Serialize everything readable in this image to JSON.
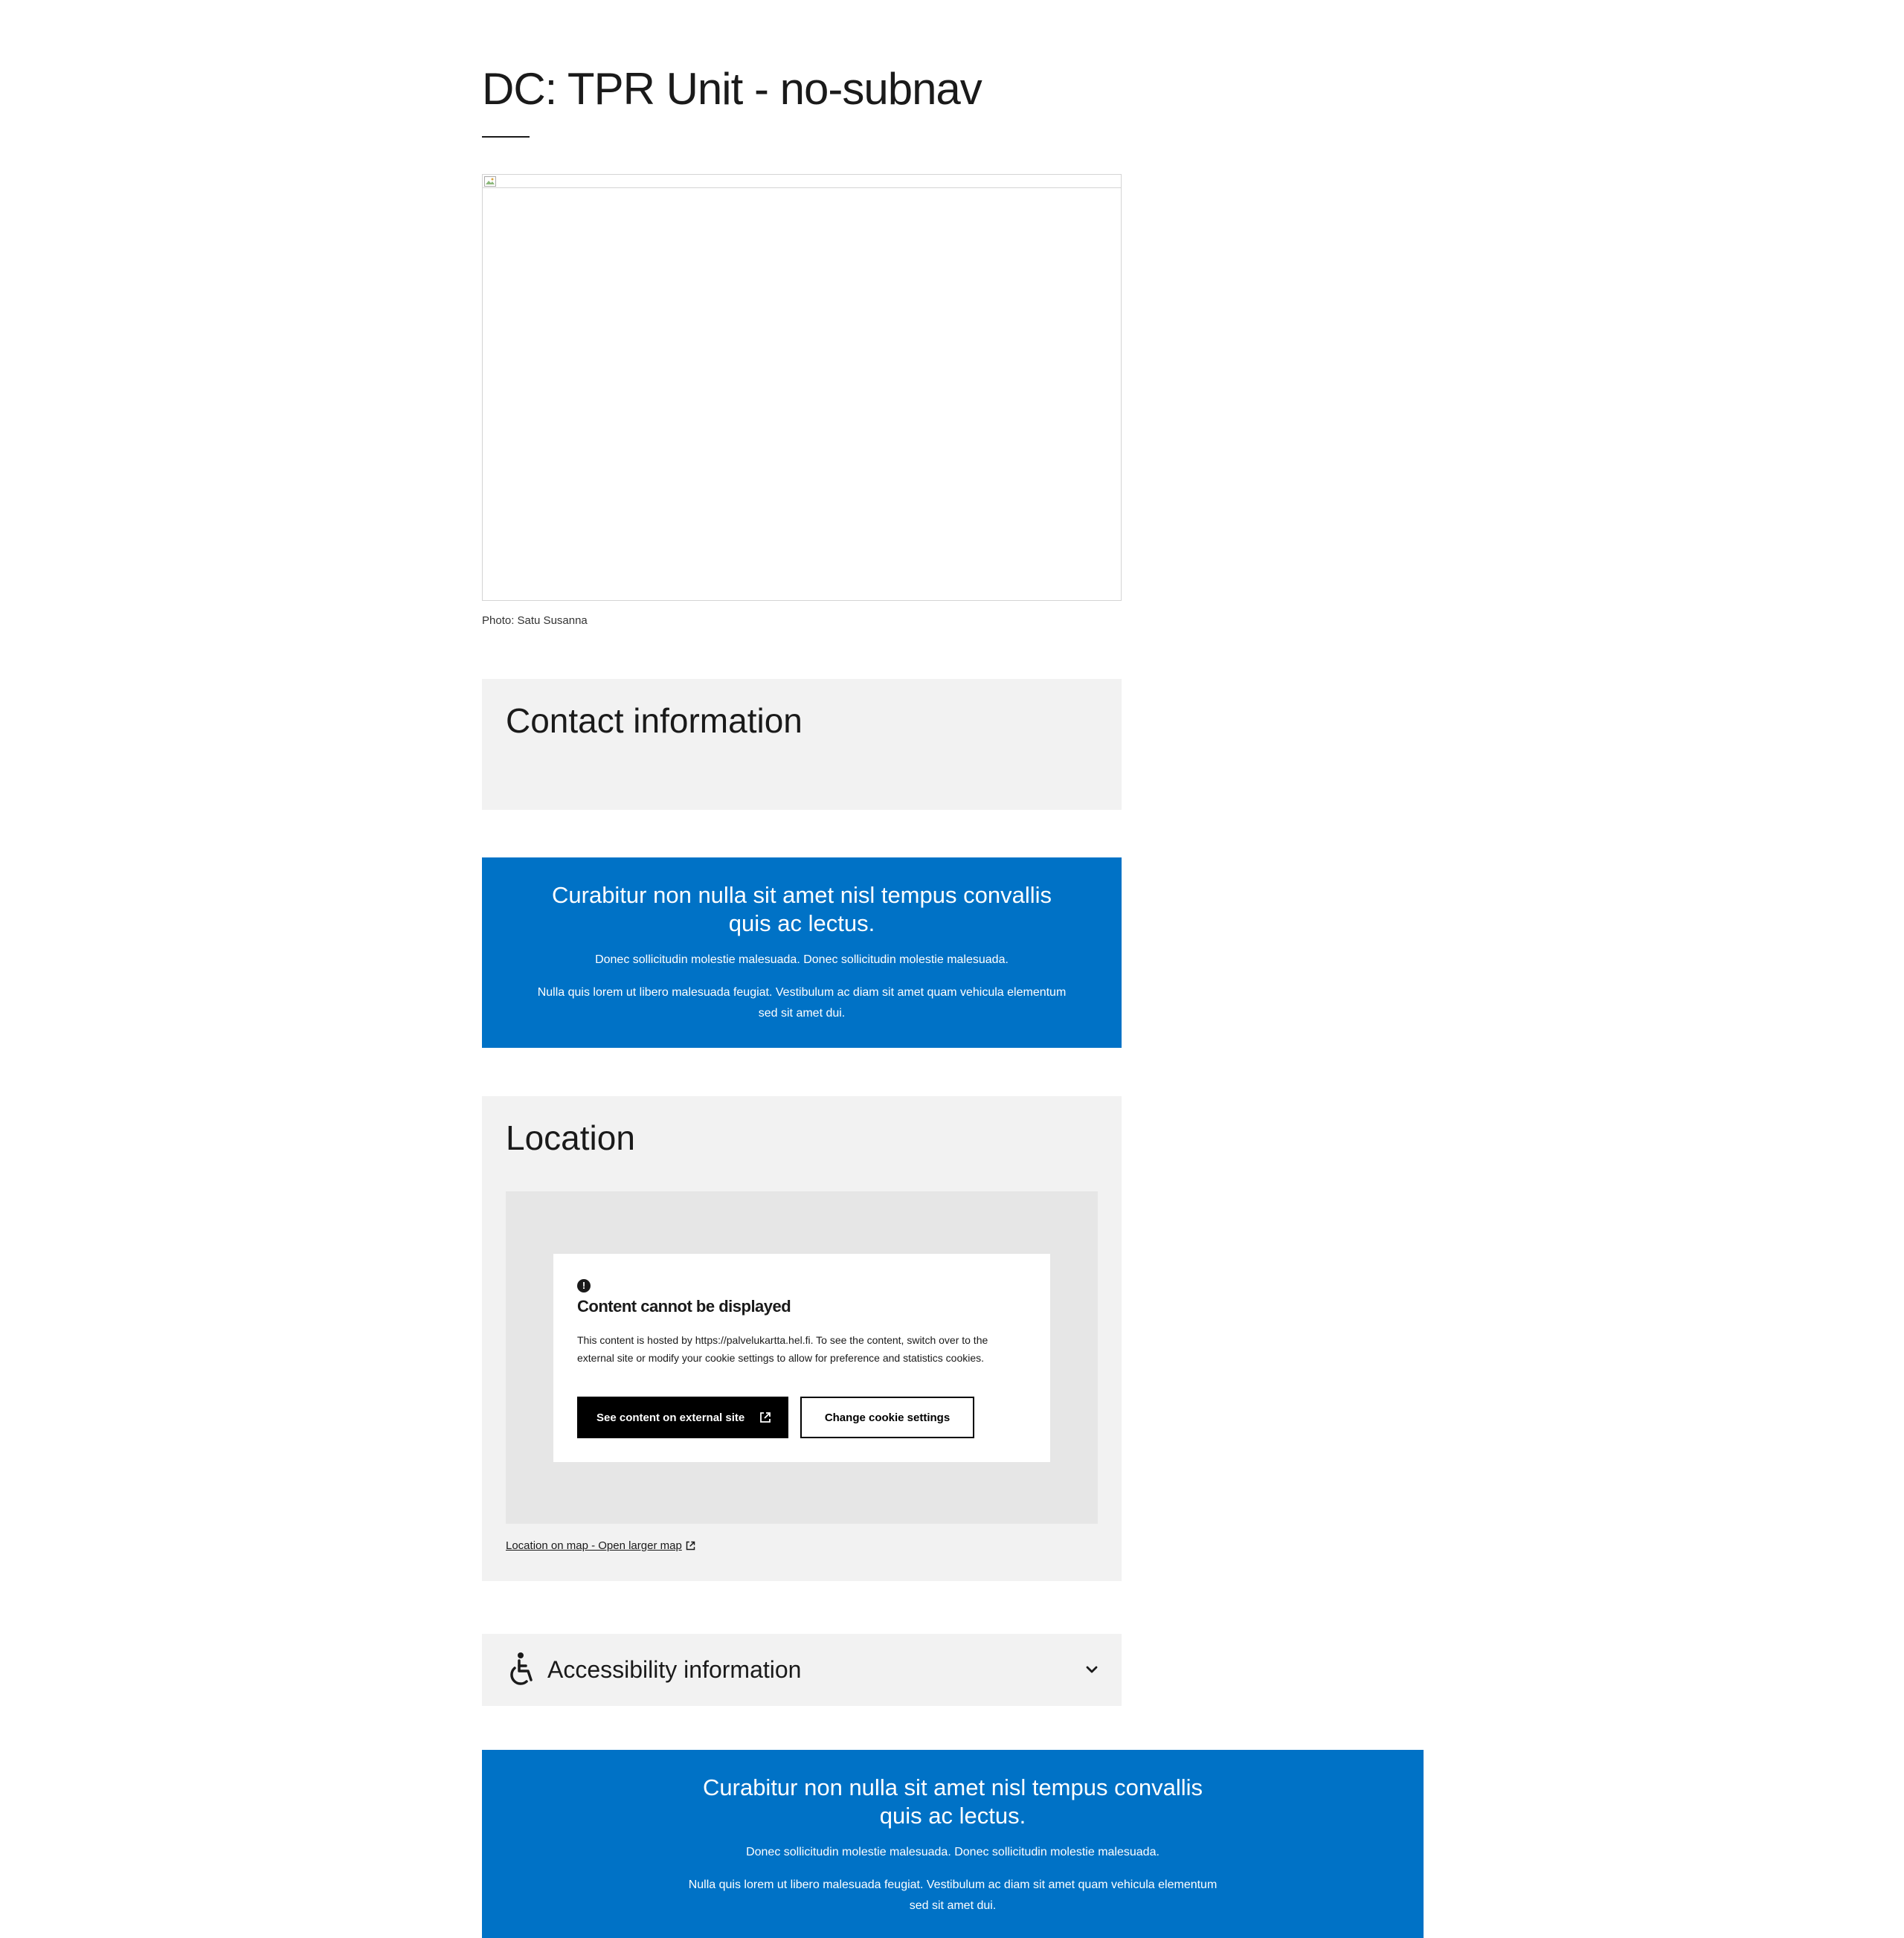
{
  "page": {
    "title": "DC: TPR Unit - no-subnav"
  },
  "hero": {
    "caption": "Photo: Satu Susanna",
    "icon": "broken-image-icon"
  },
  "contact": {
    "heading": "Contact information"
  },
  "banner1": {
    "title": "Curabitur non nulla sit amet nisl tempus convallis quis ac lectus.",
    "paragraph1": "Donec sollicitudin molestie malesuada. Donec sollicitudin molestie malesuada.",
    "paragraph2": "Nulla quis lorem ut libero malesuada feugiat. Vestibulum ac diam sit amet quam vehicula elementum sed sit amet dui."
  },
  "location": {
    "heading": "Location",
    "notice": {
      "icon": "alert-circle-icon",
      "title": "Content cannot be displayed",
      "text": "This content is hosted by https://palvelukartta.hel.fi. To see the content, switch over to the external site or modify your cookie settings to allow for preference and statistics cookies.",
      "primary_button": "See content on external site",
      "secondary_button": "Change cookie settings"
    },
    "map_link": "Location on map - Open larger map"
  },
  "accessibility": {
    "label": "Accessibility information",
    "icon": "wheelchair-icon",
    "chevron": "chevron-down-icon"
  },
  "banner2": {
    "title": "Curabitur non nulla sit amet nisl tempus convallis quis ac lectus.",
    "paragraph1": "Donec sollicitudin molestie malesuada. Donec sollicitudin molestie malesuada.",
    "paragraph2": "Nulla quis lorem ut libero malesuada feugiat. Vestibulum ac diam sit amet quam vehicula elementum sed sit amet dui."
  },
  "colors": {
    "banner_blue": "#0072c6",
    "panel_grey": "#f2f2f2",
    "map_grey": "#e6e6e6",
    "text": "#1a1a1a"
  }
}
